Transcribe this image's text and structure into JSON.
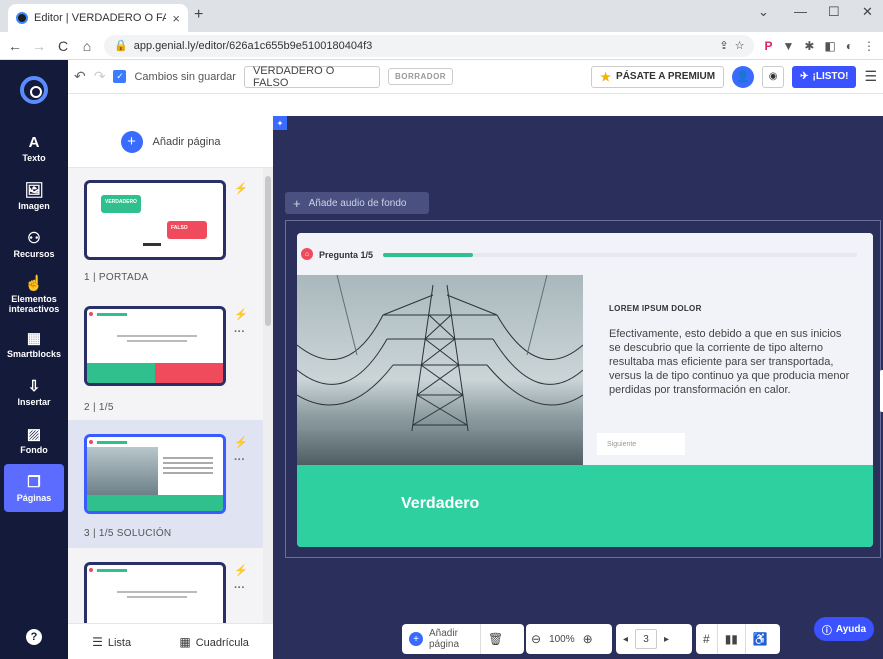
{
  "browser": {
    "tab_title": "Editor | VERDADERO O FALSO",
    "tab_close": "×",
    "new_tab": "+",
    "url": "app.genial.ly/editor/626a1c655b9e5100180404f3",
    "win_min": "—",
    "win_max": "☐",
    "win_close": "✕",
    "win_chevron": "⌄"
  },
  "editor_bar": {
    "unsaved_label": "Cambios sin guardar",
    "doc_title": "VERDADERO O FALSO",
    "draft_badge": "BORRADOR",
    "premium_label": "PÁSATE A PREMIUM",
    "ready_label": "¡LISTO!"
  },
  "rail": {
    "items": [
      {
        "label": "Texto",
        "icon": "A"
      },
      {
        "label": "Imagen",
        "icon": "🖼"
      },
      {
        "label": "Recursos",
        "icon": "⚇"
      },
      {
        "label": "Elementos interactivos",
        "icon": "☝"
      },
      {
        "label": "Smartblocks",
        "icon": "▦"
      },
      {
        "label": "Insertar",
        "icon": "⇩"
      },
      {
        "label": "Fondo",
        "icon": "▨"
      },
      {
        "label": "Páginas",
        "icon": "❐"
      }
    ],
    "help": "?"
  },
  "panel": {
    "add_page_label": "Añadir página",
    "slides": [
      {
        "label": "1 | PORTADA",
        "true_text": "VERDADERO",
        "false_text": "FALSO"
      },
      {
        "label": "2 | 1/5"
      },
      {
        "label": "3 | 1/5 SOLUCIÓN"
      },
      {
        "label": ""
      }
    ],
    "footer_list": "Lista",
    "footer_grid": "Cuadrícula"
  },
  "canvas": {
    "audio_label": "Añade audio de fondo",
    "question_label": "Pregunta 1/5",
    "question_progress": 0.19,
    "info_title": "LOREM IPSUM DOLOR",
    "info_body": "Efectivamente, esto debido a que en sus inicios se descubrio que la corriente de tipo alterno resultaba mas eficiente para ser transportada, versus la de tipo continuo ya que producia menor perdidas por transformación en calor.",
    "next_button": "Siguiente",
    "answer_label": "Verdadero"
  },
  "bottom": {
    "add_page_label": "Añadir página",
    "zoom": "100%",
    "page_number": "3"
  },
  "help_button": "Ayuda",
  "colors": {
    "rail_bg": "#141a3a",
    "canvas_bg": "#2a2f5c",
    "accent": "#3a52ff",
    "answer_green": "#2fd0a0",
    "false_red": "#ef4b5d"
  }
}
